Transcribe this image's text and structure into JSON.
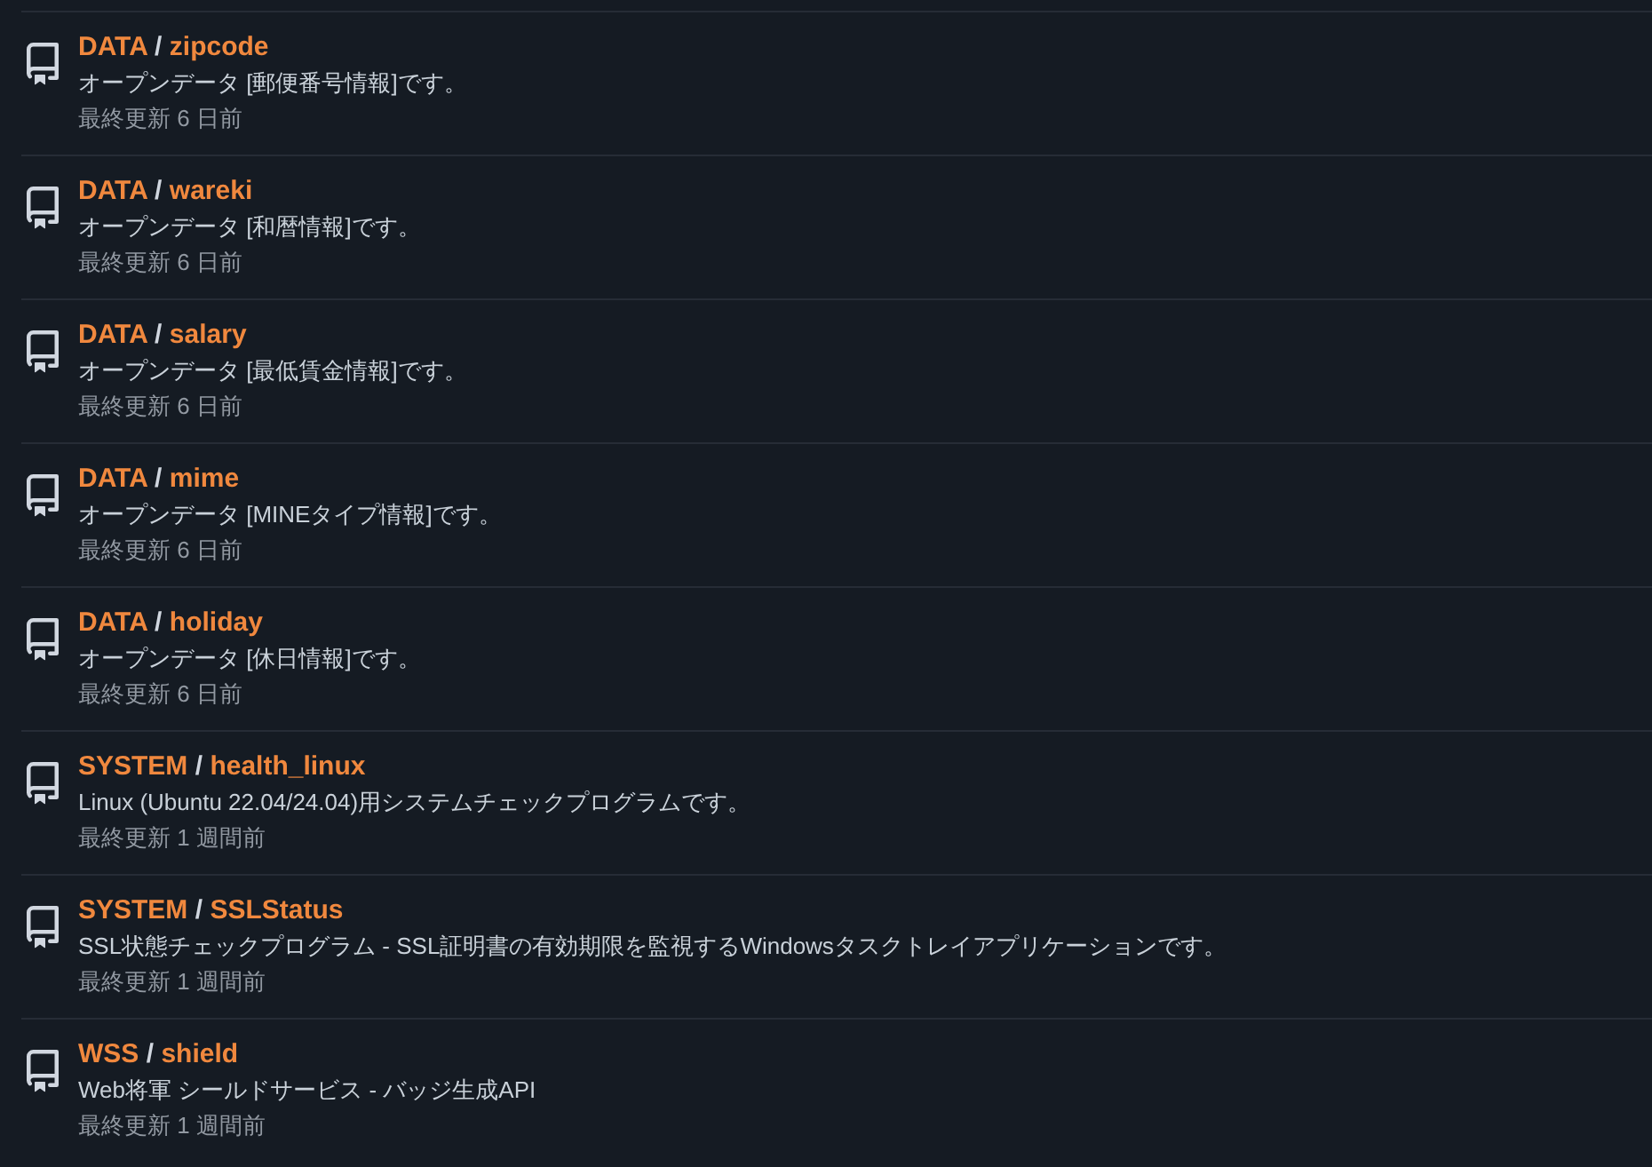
{
  "repositories": [
    {
      "owner": "DATA",
      "separator": "/",
      "name": "zipcode",
      "description": "オープンデータ [郵便番号情報]です。",
      "updated": "最終更新 6 日前"
    },
    {
      "owner": "DATA",
      "separator": "/",
      "name": "wareki",
      "description": "オープンデータ [和暦情報]です。",
      "updated": "最終更新 6 日前"
    },
    {
      "owner": "DATA",
      "separator": "/",
      "name": "salary",
      "description": "オープンデータ [最低賃金情報]です。",
      "updated": "最終更新 6 日前"
    },
    {
      "owner": "DATA",
      "separator": "/",
      "name": "mime",
      "description": "オープンデータ [MINEタイプ情報]です。",
      "updated": "最終更新 6 日前"
    },
    {
      "owner": "DATA",
      "separator": "/",
      "name": "holiday",
      "description": "オープンデータ [休日情報]です。",
      "updated": "最終更新 6 日前"
    },
    {
      "owner": "SYSTEM",
      "separator": "/",
      "name": "health_linux",
      "description": "Linux (Ubuntu 22.04/24.04)用システムチェックプログラムです。",
      "updated": "最終更新 1 週間前"
    },
    {
      "owner": "SYSTEM",
      "separator": "/",
      "name": "SSLStatus",
      "description": "SSL状態チェックプログラム - SSL証明書の有効期限を監視するWindowsタスクトレイアプリケーションです。",
      "updated": "最終更新 1 週間前"
    },
    {
      "owner": "WSS",
      "separator": "/",
      "name": "shield",
      "description": "Web将軍 シールドサービス - バッジ生成API",
      "updated": "最終更新 1 週間前"
    }
  ]
}
